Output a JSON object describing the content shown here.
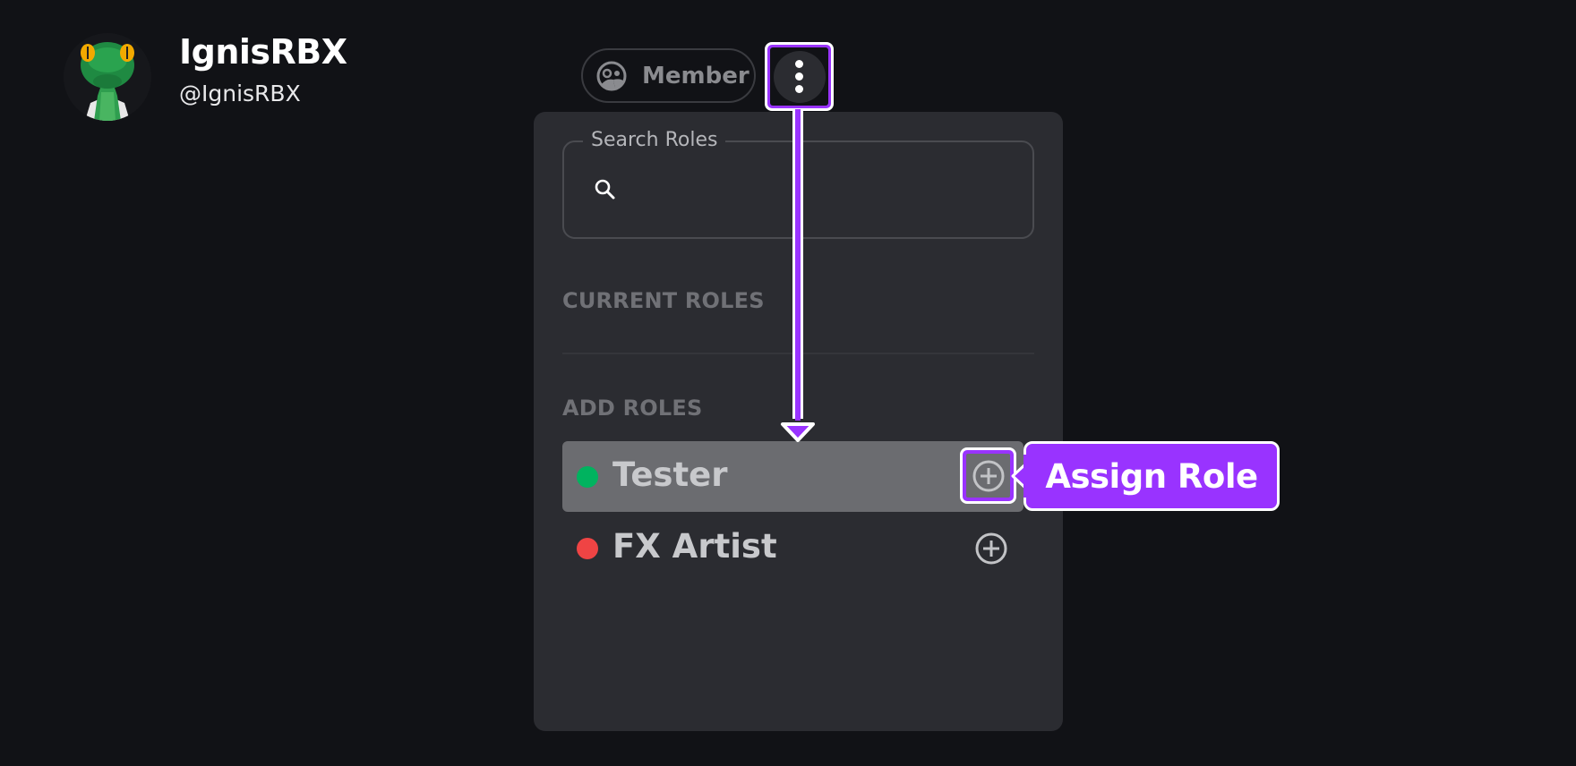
{
  "header": {
    "display_name": "IgnisRBX",
    "handle": "@IgnisRBX",
    "avatar_icon": "lizard-avatar"
  },
  "role_button": {
    "label": "Member",
    "icon": "member-role-icon"
  },
  "more_menu": {
    "icon": "kebab-vertical-icon"
  },
  "roles_panel": {
    "search": {
      "label": "Search Roles",
      "value": "",
      "placeholder": ""
    },
    "current_roles_label": "CURRENT ROLES",
    "current_roles": [],
    "add_roles_label": "ADD ROLES",
    "add_roles": [
      {
        "name": "Tester",
        "color": "#00b35f",
        "highlighted": true
      },
      {
        "name": "FX Artist",
        "color": "#ef4444",
        "highlighted": false
      }
    ]
  },
  "annotation": {
    "callout_label": "Assign Role",
    "accent_color": "#9933ff"
  }
}
